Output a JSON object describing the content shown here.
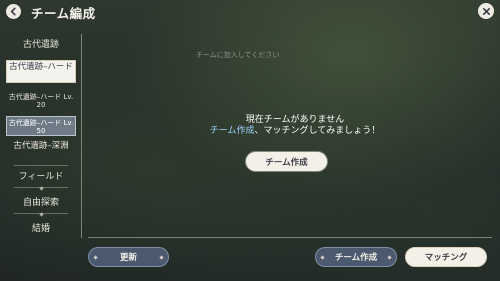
{
  "header": {
    "title": "チーム編成"
  },
  "sidebar": {
    "items": [
      {
        "label": "古代遺跡"
      },
      {
        "label": "古代遺跡–ハード"
      },
      {
        "label": "古代遺跡–ハード Lv. 20"
      },
      {
        "label": "古代遺跡–ハード Lv. 50"
      },
      {
        "label": "古代遺跡–深淵"
      },
      {
        "label": "フィールド"
      },
      {
        "label": "自由探索"
      },
      {
        "label": "結婚"
      }
    ]
  },
  "main": {
    "placeholder": "チームに加入してください",
    "empty_line1": "現在チームがありません",
    "empty_line2_link": "チーム作成",
    "empty_line2_rest": "、マッチングしてみましょう！",
    "center_button": "チーム作成"
  },
  "footer": {
    "refresh_label": "更新",
    "create_label": "チーム作成",
    "matching_label": "マッチング"
  },
  "colors": {
    "accent_link": "#9fd3ff",
    "button_light": "#f3f0e8",
    "button_dark": "#5a6987"
  }
}
